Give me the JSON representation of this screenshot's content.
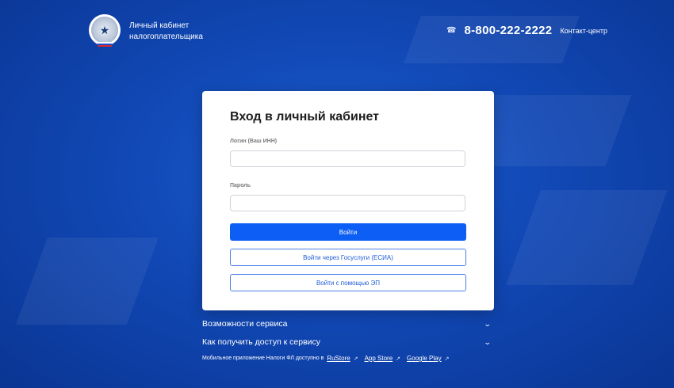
{
  "header": {
    "brand_line1": "Личный кабинет",
    "brand_line2": "налогоплательщика",
    "phone": "8-800-222-2222",
    "contact_label": "Контакт-центр"
  },
  "login": {
    "title": "Вход в личный кабинет",
    "login_label": "Логин (Ваш ИНН)",
    "login_value": "",
    "password_label": "Пароль",
    "password_value": "",
    "submit_label": "Войти",
    "gosuslugi_label": "Войти через Госуслуги (ЕСИА)",
    "ep_label": "Войти с помощью ЭП"
  },
  "accordion": [
    {
      "label": "Возможности сервиса"
    },
    {
      "label": "Как получить доступ к сервису"
    }
  ],
  "mobile": {
    "text": "Мобильное приложение Налоги ФЛ доступно в",
    "links": [
      "RuStore",
      "App Store",
      "Google Play"
    ]
  },
  "icons": {
    "phone": "phone-icon",
    "chevron": "chevron-down-icon",
    "external": "external-link-icon"
  },
  "colors": {
    "primary": "#0d5ef5",
    "background": "#1148b5"
  }
}
